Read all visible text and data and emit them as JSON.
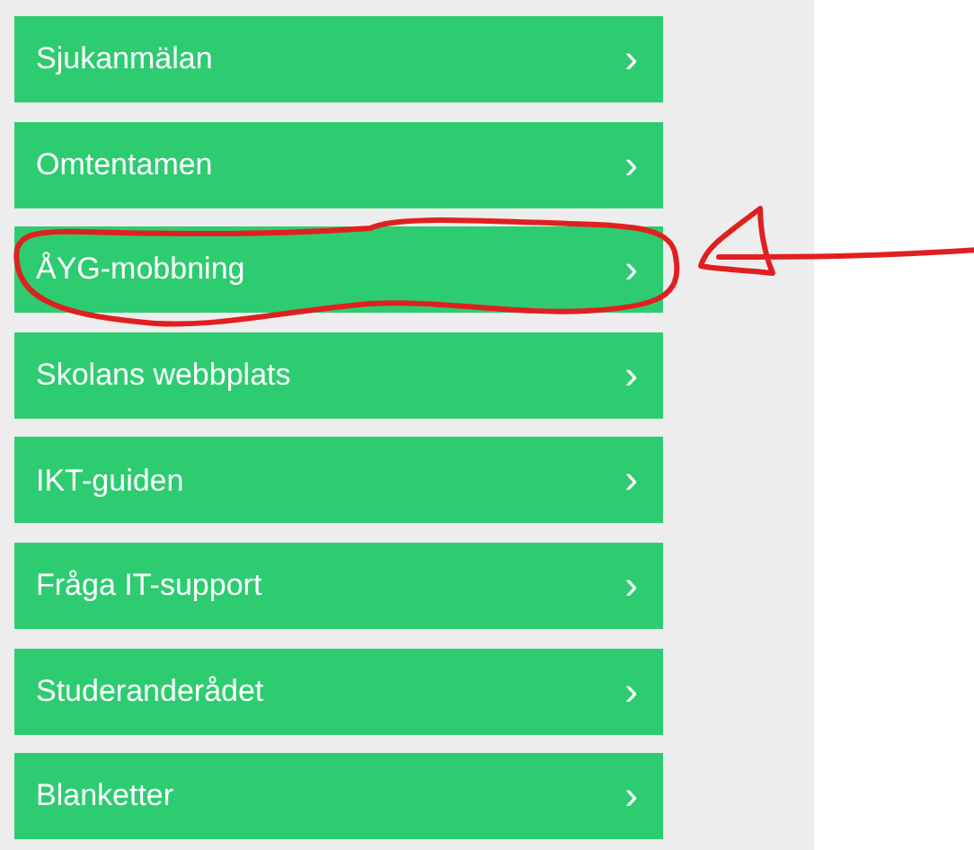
{
  "links": [
    {
      "label": "Sjukanmälan",
      "chevron": "›",
      "annotated": false
    },
    {
      "label": "Omtentamen",
      "chevron": "›",
      "annotated": false
    },
    {
      "label": "ÅYG-mobbning",
      "chevron": "›",
      "annotated": true
    },
    {
      "label": "Skolans webbplats",
      "chevron": "›",
      "annotated": false
    },
    {
      "label": "IKT-guiden",
      "chevron": "›",
      "annotated": false
    },
    {
      "label": "Fråga IT-support",
      "chevron": "›",
      "annotated": false
    },
    {
      "label": "Studeranderådet",
      "chevron": "›",
      "annotated": false
    },
    {
      "label": "Blanketter",
      "chevron": "›",
      "annotated": false
    }
  ]
}
